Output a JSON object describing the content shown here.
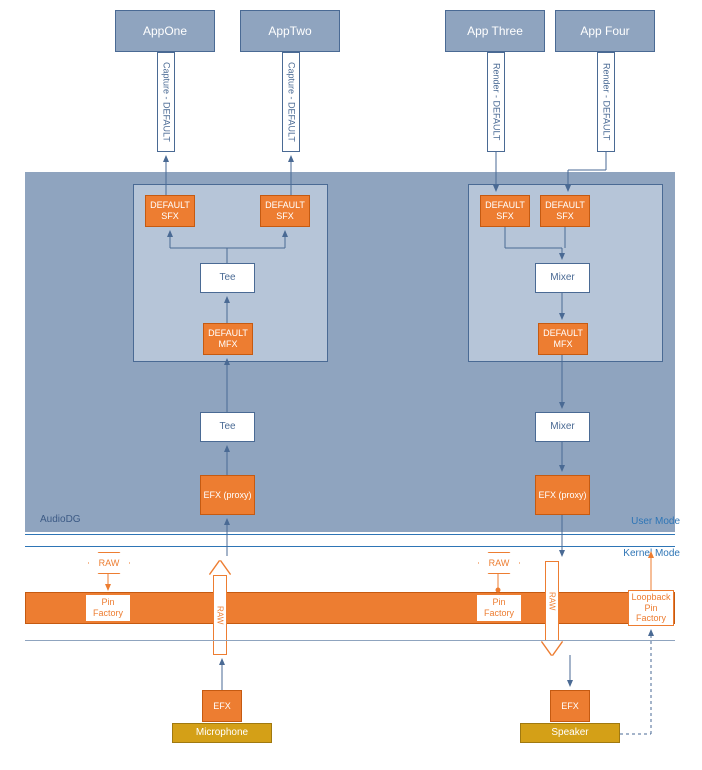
{
  "apps": [
    "AppOne",
    "AppTwo",
    "App Three",
    "App Four"
  ],
  "captures": [
    "Capture - DEFAULT",
    "Capture - DEFAULT",
    "Render - DEFAULT",
    "Render - DEFAULT"
  ],
  "sfx": "DEFAULT SFX",
  "mfx": "DEFAULT MFX",
  "tee": "Tee",
  "mixer": "Mixer",
  "efx_proxy": "EFX (proxy)",
  "efx": "EFX",
  "audiodg": "AudioDG",
  "user_mode": "User Mode",
  "kernel_mode": "Kernel Mode",
  "raw": "RAW",
  "pin_factory": "Pin Factory",
  "loopback": "Loopback Pin Factory",
  "microphone": "Microphone",
  "speaker": "Speaker"
}
